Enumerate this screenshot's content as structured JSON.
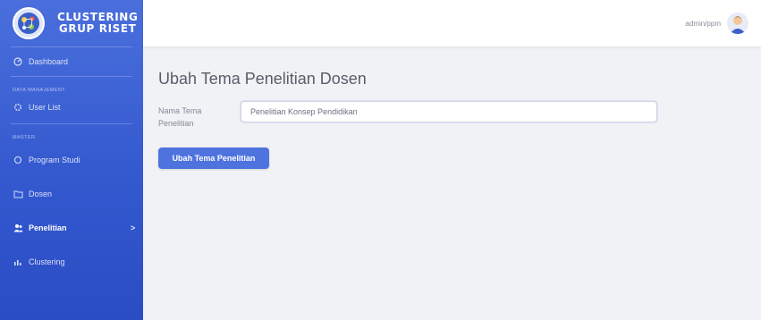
{
  "brand": {
    "line1": "CLUSTERING",
    "line2": "GRUP RISET"
  },
  "sidebar": {
    "dashboard": "Dashboard",
    "section_user": "DATA MANAJEMENT",
    "user_list": "User List",
    "section_master": "MASTER",
    "items": [
      {
        "label": "Program Studi",
        "icon": "circle-icon"
      },
      {
        "label": "Dosen",
        "icon": "folder-icon"
      },
      {
        "label": "Penelitian",
        "icon": "users-icon",
        "active": true
      },
      {
        "label": "Clustering",
        "icon": "chart-icon"
      }
    ],
    "chevron": ">"
  },
  "topbar": {
    "username": "admin/ppm"
  },
  "page": {
    "title": "Ubah Tema Penelitian Dosen",
    "field_label_1": "Nama Tema",
    "field_label_2": "Penelitian",
    "field_value": "Penelitian Konsep Pendidikan",
    "submit_label": "Ubah Tema Penelitian"
  },
  "colors": {
    "sidebar": "#4a6fdc",
    "accent": "#4e73df",
    "background": "#f1f2f6"
  }
}
